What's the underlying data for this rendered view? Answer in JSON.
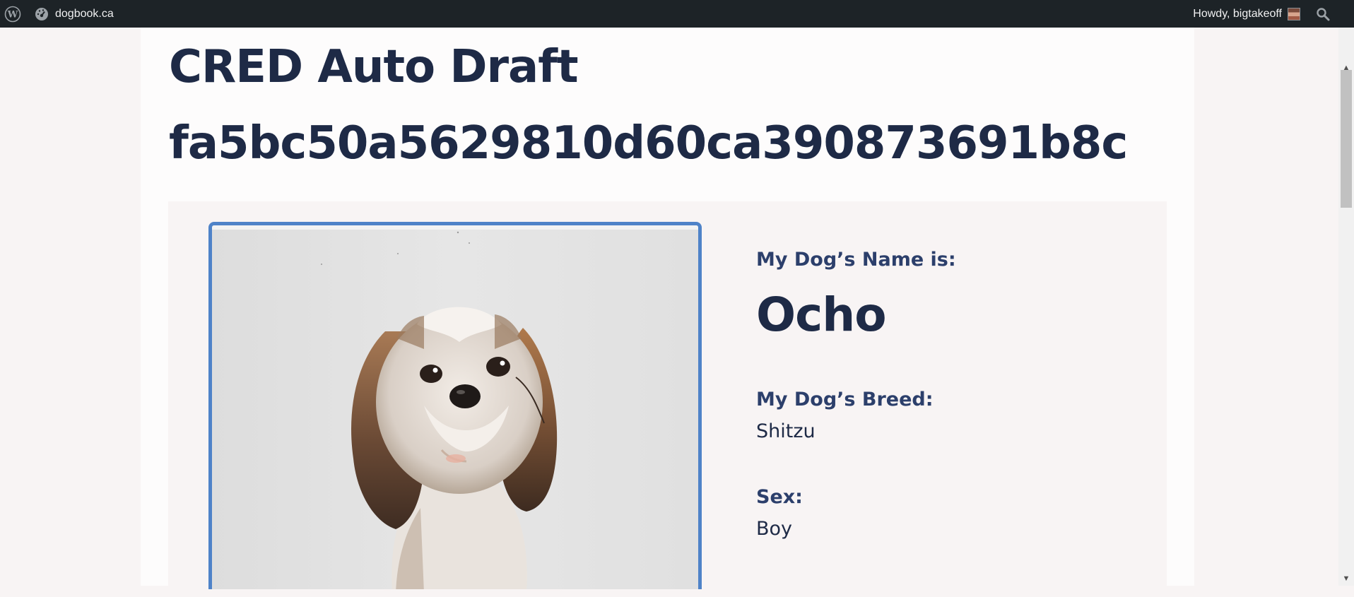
{
  "adminbar": {
    "site_name": "dogbook.ca",
    "greeting": "Howdy, bigtakeoff",
    "icons": [
      "wordpress-logo-icon",
      "dashboard-icon",
      "avatar",
      "search-icon"
    ]
  },
  "post": {
    "title": "CRED Auto Draft fa5bc50a5629810d60ca390873691b8c"
  },
  "dog": {
    "name_label": "My Dog’s Name is:",
    "name": "Ocho",
    "breed_label": "My Dog’s Breed:",
    "breed": "Shitzu",
    "sex_label": "Sex:",
    "sex": "Boy"
  },
  "colors": {
    "adminbar_bg": "#1d2327",
    "heading": "#1e2a46",
    "label": "#2c3f6b",
    "photo_border": "#4f83c8",
    "page_bg": "#f8f4f4"
  }
}
